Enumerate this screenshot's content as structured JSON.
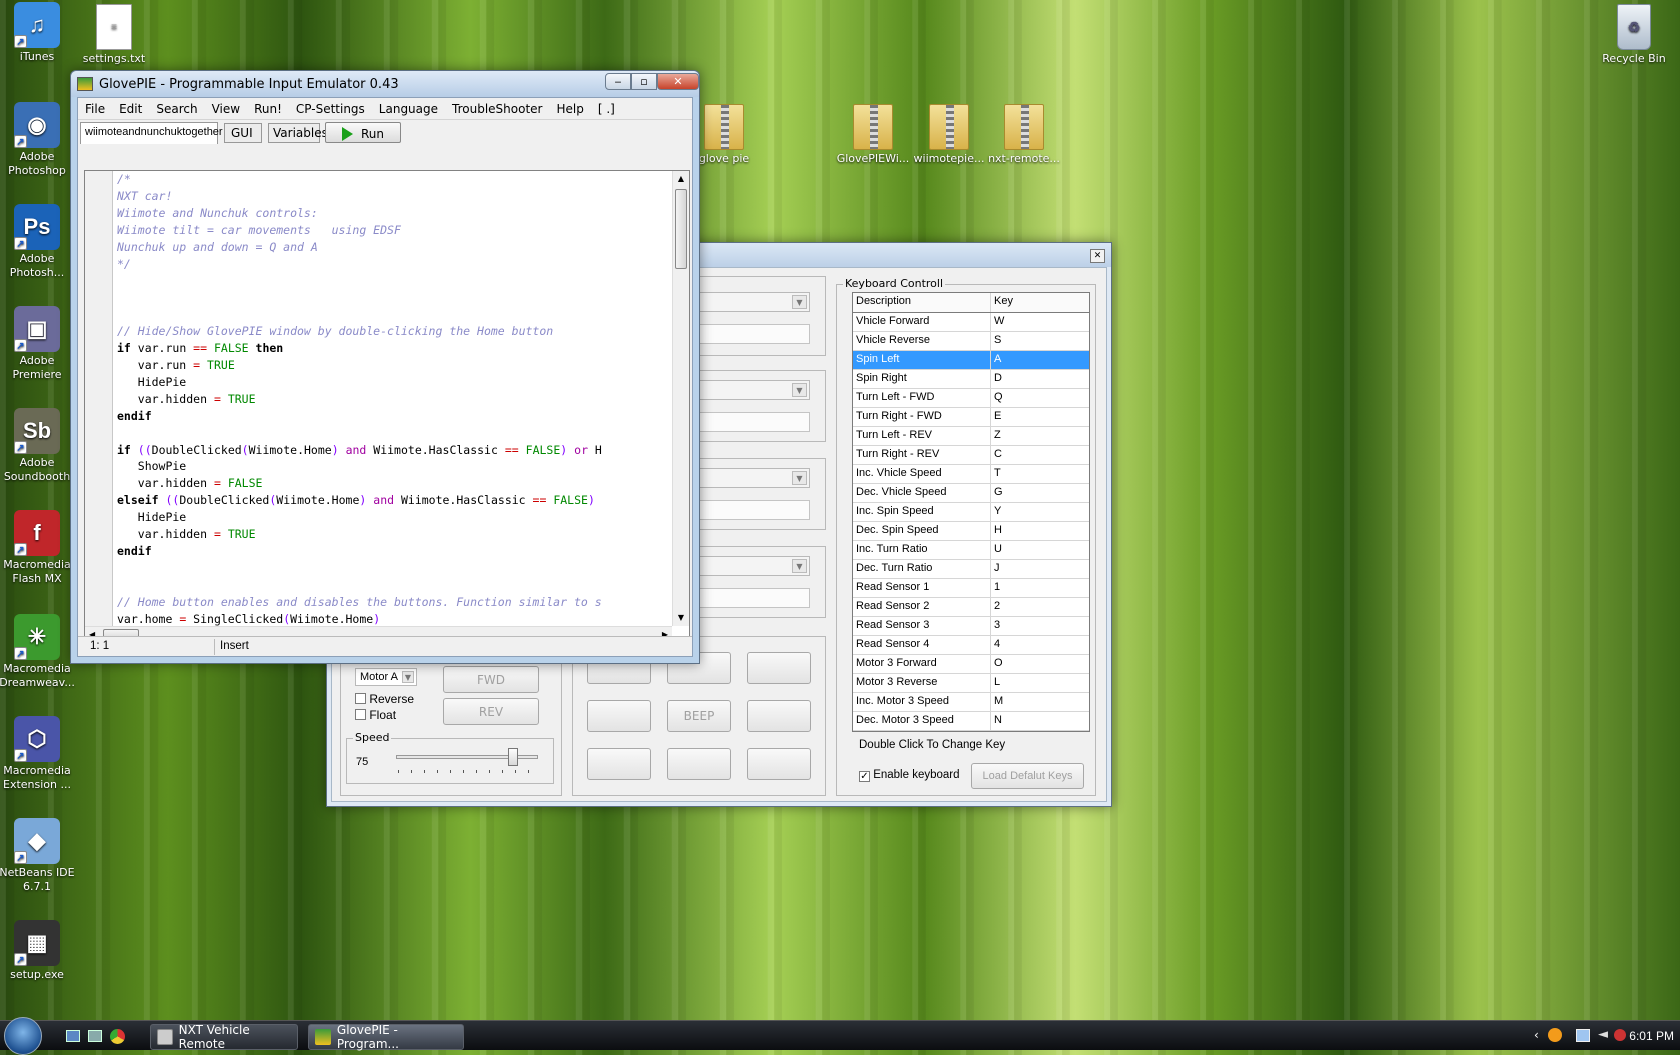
{
  "desktop_icons": [
    {
      "label": "iTunes",
      "glyph": "♫",
      "color": "#3a8de0",
      "icon": "itunes-icon"
    },
    {
      "label": "Adobe Photoshop",
      "glyph": "◉",
      "color": "#3a6fb5",
      "icon": "camera-icon"
    },
    {
      "label": "Adobe Photosh...",
      "glyph": "Ps",
      "color": "#1b63b8",
      "icon": "photoshop-icon"
    },
    {
      "label": "Adobe Premiere",
      "glyph": "▣",
      "color": "#6b6b9a",
      "icon": "premiere-icon"
    },
    {
      "label": "Adobe Soundbooth",
      "glyph": "Sb",
      "color": "#6a6a55",
      "icon": "soundbooth-icon"
    },
    {
      "label": "Macromedia Flash MX",
      "glyph": "f",
      "color": "#c0262a",
      "icon": "flash-icon"
    },
    {
      "label": "Macromedia Dreamweav...",
      "glyph": "✳",
      "color": "#3c9a2e",
      "icon": "dreamweaver-icon"
    },
    {
      "label": "Macromedia Extension ...",
      "glyph": "⬡",
      "color": "#4a55a8",
      "icon": "extension-manager-icon"
    },
    {
      "label": "NetBeans IDE 6.7.1",
      "glyph": "◆",
      "color": "#7aa8d8",
      "icon": "netbeans-icon"
    },
    {
      "label": "setup.exe",
      "glyph": "▦",
      "color": "#333333",
      "icon": "setup-icon"
    }
  ],
  "desktop_files": {
    "settings": "settings.txt",
    "recycle_bin": "Recycle Bin",
    "glove_pie": "glove pie",
    "zip1": "GlovePIEWi...",
    "zip2": "wiimotepie...",
    "zip3": "nxt-remote..."
  },
  "glovepie": {
    "title": "GlovePIE - Programmable Input Emulator 0.43",
    "menu": [
      "File",
      "Edit",
      "Search",
      "View",
      "Run!",
      "CP-Settings",
      "Language",
      "TroubleShooter",
      "Help",
      "[ .]"
    ],
    "tabs": {
      "script": "wiimoteandnunchuktogether",
      "gui": "GUI",
      "variables": "Variables",
      "run": "Run"
    },
    "status": {
      "position": "1: 1",
      "mode": "Insert"
    }
  },
  "nxt": {
    "motor_select": "Motor A",
    "fwd": "FWD",
    "rev": "REV",
    "reverse": "Reverse",
    "float": "Float",
    "speed_group": "Speed",
    "speed_value": "75",
    "speed_level": 0.85,
    "beep": "BEEP",
    "keyboard_group": "Keyboard Controll",
    "col_description": "Description",
    "col_key": "Key",
    "rows": [
      {
        "d": "Vhicle Forward",
        "k": "W"
      },
      {
        "d": "Vhicle Reverse",
        "k": "S"
      },
      {
        "d": "Spin Left",
        "k": "A"
      },
      {
        "d": "Spin Right",
        "k": "D"
      },
      {
        "d": "Turn Left - FWD",
        "k": "Q"
      },
      {
        "d": "Turn Right - FWD",
        "k": "E"
      },
      {
        "d": "Turn Left - REV",
        "k": "Z"
      },
      {
        "d": "Turn Right - REV",
        "k": "C"
      },
      {
        "d": "Inc. Vhicle Speed",
        "k": "T"
      },
      {
        "d": "Dec. Vhicle Speed",
        "k": "G"
      },
      {
        "d": "Inc. Spin Speed",
        "k": "Y"
      },
      {
        "d": "Dec. Spin Speed",
        "k": "H"
      },
      {
        "d": "Inc. Turn Ratio",
        "k": "U"
      },
      {
        "d": "Dec. Turn Ratio",
        "k": "J"
      },
      {
        "d": "Read Sensor 1",
        "k": "1"
      },
      {
        "d": "Read Sensor 2",
        "k": "2"
      },
      {
        "d": "Read Sensor 3",
        "k": "3"
      },
      {
        "d": "Read Sensor 4",
        "k": "4"
      },
      {
        "d": "Motor 3 Forward",
        "k": "O"
      },
      {
        "d": "Motor 3 Reverse",
        "k": "L"
      },
      {
        "d": "Inc. Motor 3 Speed",
        "k": "M"
      },
      {
        "d": "Dec. Motor  3 Speed",
        "k": "N"
      }
    ],
    "selected_row": 2,
    "hint": "Double Click To Change Key",
    "enable_keyboard": "Enable keyboard",
    "enable_keyboard_checked": true,
    "load_default": "Load Defalut Keys"
  },
  "taskbar": {
    "item1": "NXT Vehicle Remote",
    "item2": "GlovePIE - Program...",
    "clock": "6:01 PM"
  }
}
